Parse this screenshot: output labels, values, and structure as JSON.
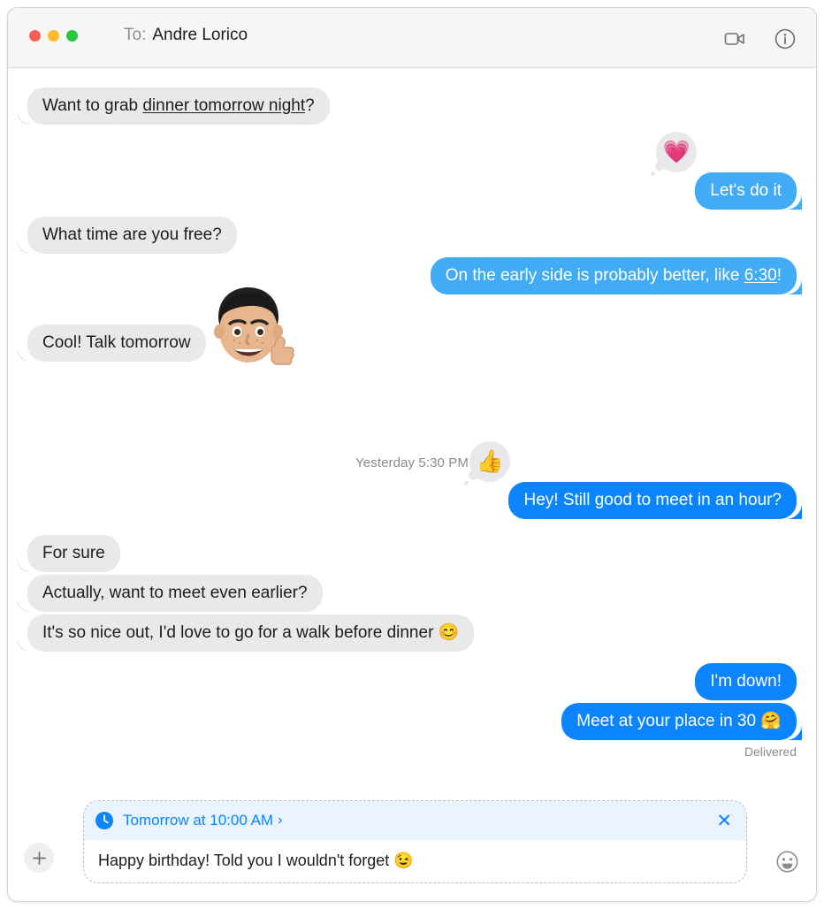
{
  "window": {
    "traffic_lights": [
      {
        "name": "close",
        "color": "#ff5f57"
      },
      {
        "name": "minimize",
        "color": "#febb2e"
      },
      {
        "name": "zoom",
        "color": "#28c840"
      }
    ],
    "to_label": "To:",
    "recipient": "Andre Lorico",
    "actions": [
      {
        "name": "facetime-video-icon",
        "label": "FaceTime"
      },
      {
        "name": "info-icon",
        "label": "Details"
      }
    ]
  },
  "conversation": {
    "day_divider": "Yesterday 5:30 PM",
    "delivered_label": "Delivered",
    "messages": [
      {
        "id": "m1",
        "side": "incoming",
        "text_before": "Want to grab ",
        "text_link": "dinner tomorrow night",
        "text_after": "?",
        "tapback": null
      },
      {
        "id": "m2",
        "side": "outgoing",
        "text": "Let's do it",
        "tapback": "heart",
        "tapback_emoji": "💗"
      },
      {
        "id": "m3",
        "side": "incoming",
        "text": "What time are you free?"
      },
      {
        "id": "m4",
        "side": "outgoing",
        "text_before": "On the early side is probably better, like ",
        "text_link": "6:30",
        "text_after": "!"
      },
      {
        "id": "m5",
        "side": "incoming",
        "text": "Cool! Talk tomorrow",
        "sticker": "memoji-thumbs-up",
        "sticker_emoji": "👍"
      },
      {
        "id": "m6",
        "side": "outgoing",
        "text": "Hey! Still good to meet in an hour?",
        "tapback": "thumbs-up",
        "tapback_emoji": "👍"
      },
      {
        "id": "m7",
        "side": "incoming",
        "text": "For sure"
      },
      {
        "id": "m8",
        "side": "incoming",
        "text": "Actually, want to meet even earlier?"
      },
      {
        "id": "m9",
        "side": "incoming",
        "text": "It's so nice out, I'd love to go for a walk before dinner 😊"
      },
      {
        "id": "m10",
        "side": "outgoing",
        "text": "I'm down!"
      },
      {
        "id": "m11",
        "side": "outgoing",
        "text": "Meet at your place in 30 🤗"
      }
    ]
  },
  "compose": {
    "add_button_label": "+",
    "schedule": {
      "icon": "clock-icon",
      "text": "Tomorrow at 10:00 AM",
      "chevron": "›",
      "close_label": "✕"
    },
    "draft_text": "Happy birthday! Told you I wouldn't forget 😉",
    "emoji_button": "emoji-picker"
  },
  "colors": {
    "bubble_incoming": "#e9e9eb",
    "bubble_outgoing_light": "#41abf5",
    "bubble_outgoing": "#0b84fe",
    "accent": "#0b84fe",
    "schedule_bg": "#eaf4ff",
    "titlebar_bg": "#f6f6f6"
  }
}
